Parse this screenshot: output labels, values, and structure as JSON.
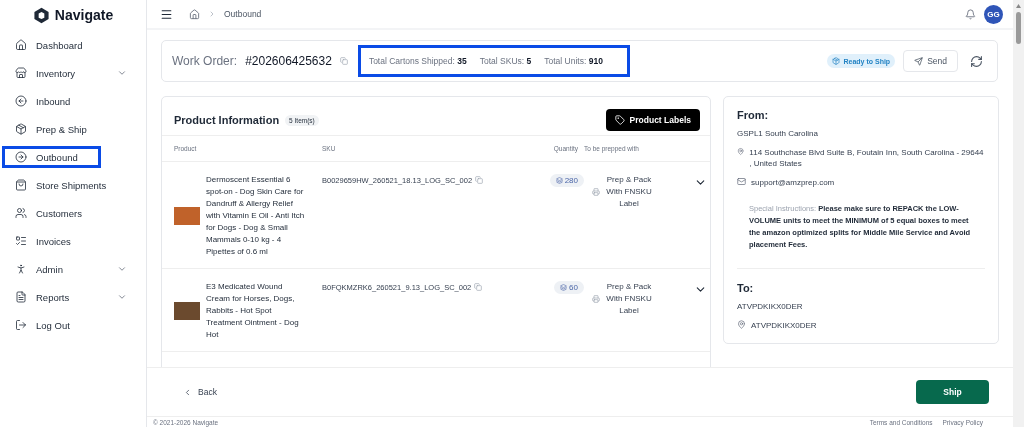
{
  "brand": "Navigate",
  "sidebar": {
    "items": [
      {
        "label": "Dashboard",
        "expandable": false,
        "selected": false
      },
      {
        "label": "Inventory",
        "expandable": true,
        "selected": false
      },
      {
        "label": "Inbound",
        "expandable": false,
        "selected": false
      },
      {
        "label": "Prep & Ship",
        "expandable": false,
        "selected": false
      },
      {
        "label": "Outbound",
        "expandable": false,
        "selected": true
      },
      {
        "label": "Store Shipments",
        "expandable": false,
        "selected": false
      },
      {
        "label": "Customers",
        "expandable": false,
        "selected": false
      },
      {
        "label": "Invoices",
        "expandable": false,
        "selected": false
      },
      {
        "label": "Admin",
        "expandable": true,
        "selected": false
      },
      {
        "label": "Reports",
        "expandable": true,
        "selected": false
      },
      {
        "label": "Log Out",
        "expandable": false,
        "selected": false
      }
    ]
  },
  "breadcrumb": "Outbound",
  "avatar": "GG",
  "work_order": {
    "label": "Work Order:",
    "number": "#202606425632",
    "stats": [
      {
        "label": "Total Cartons Shipped:",
        "value": "35"
      },
      {
        "label": "Total SKUs:",
        "value": "5"
      },
      {
        "label": "Total Units:",
        "value": "910"
      }
    ],
    "status": "Ready to Ship",
    "send": "Send"
  },
  "products": {
    "title": "Product Information",
    "count": "5 Item(s)",
    "labels_button": "Product Labels",
    "columns": [
      "Product",
      "SKU",
      "Quantity",
      "To be prepped with"
    ],
    "rows": [
      {
        "name": "Dermoscent Essential 6 spot-on - Dog Skin Care for Dandruff & Allergy Relief with Vitamin E Oil - Anti Itch for Dogs - Dog & Small Mammals 0-10 kg - 4 Pipettes of 0.6 ml",
        "sku": "B0029659HW_260521_18.13_LOG_SC_002",
        "quantity": "280",
        "prep": "Prep & Pack With FNSKU Label"
      },
      {
        "name": "E3 Medicated Wound Cream for Horses, Dogs, Rabbits - Hot Spot Treatment Ointment - Dog Hot",
        "sku": "B0FQKMZRK6_260521_9.13_LOG_SC_002",
        "quantity": "60",
        "prep": "Prep & Pack With FNSKU Label"
      }
    ]
  },
  "from": {
    "title": "From:",
    "name": "GSPL1 South Carolina",
    "address": "114 Southchase Blvd Suite B, Foutain Inn, South Carolina - 29644 , United States",
    "email": "support@amzprep.com",
    "instructions_label": "Special Instructions:",
    "instructions": "Please make sure to REPACK the LOW-VOLUME units to meet the MINIMUM of 5 equal boxes to meet the amazon optimized splits for Middle Mile Service and Avoid placement Fees."
  },
  "to": {
    "title": "To:",
    "name": "ATVPDKIKX0DER",
    "address": "ATVPDKIKX0DER"
  },
  "actions": {
    "back": "Back",
    "ship": "Ship"
  },
  "footer": {
    "copyright": "© 2021-2026 Navigate",
    "terms": "Terms and Conditions",
    "privacy": "Privacy Policy"
  }
}
